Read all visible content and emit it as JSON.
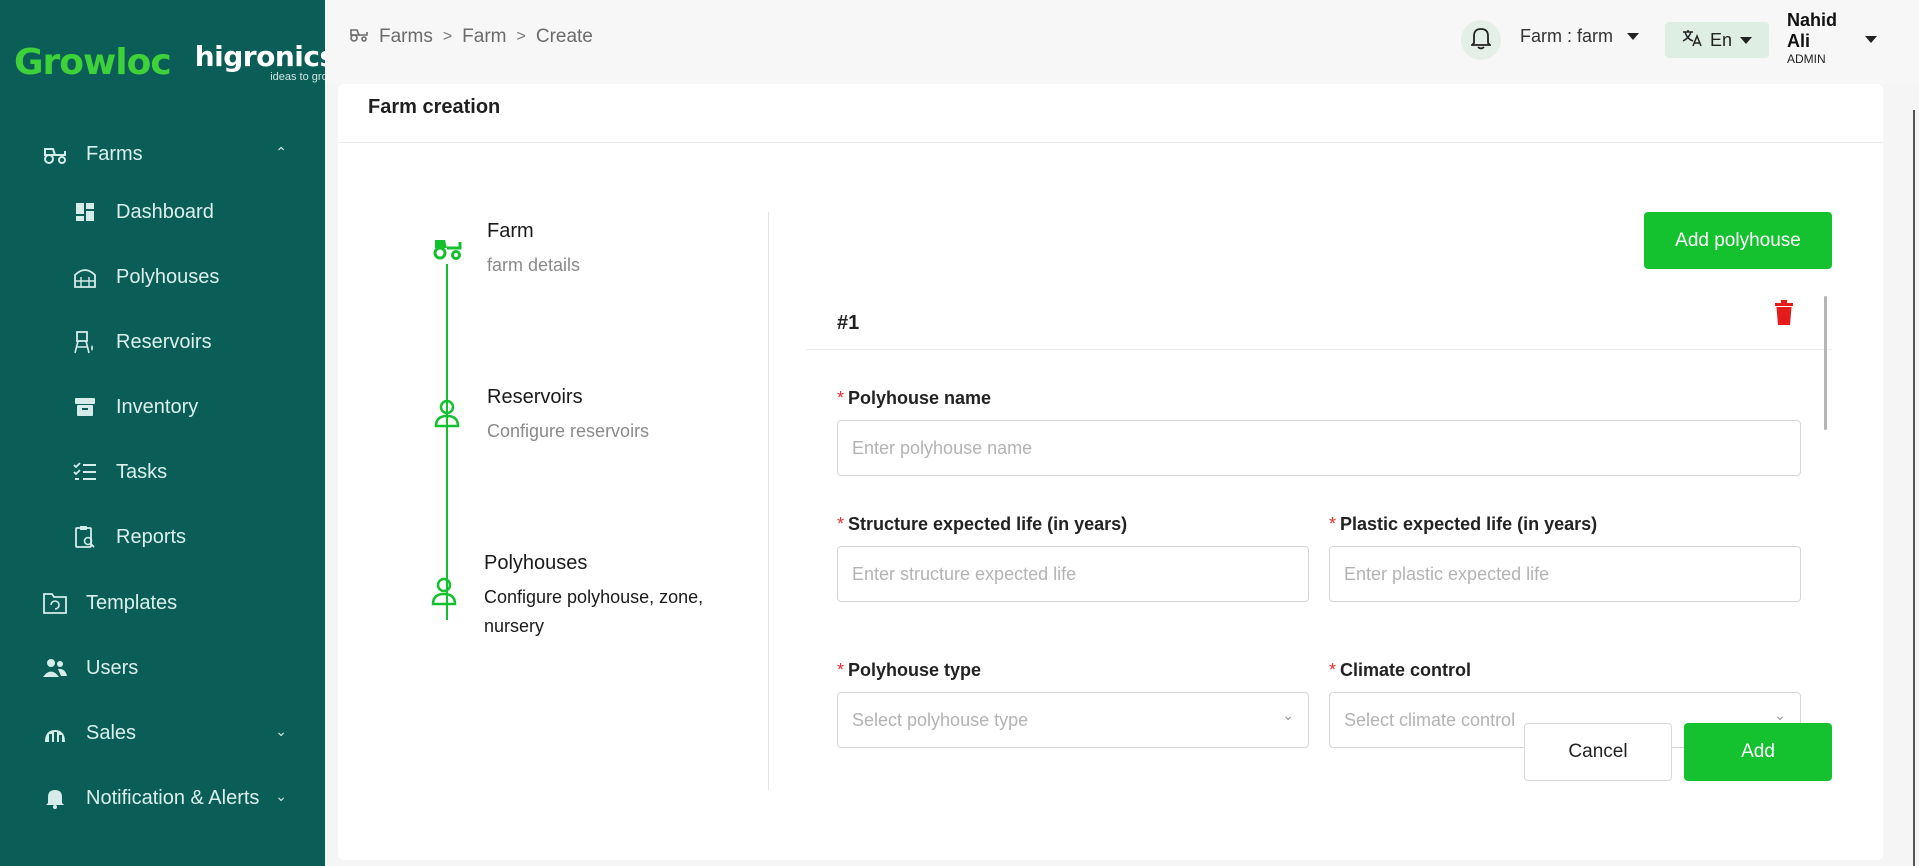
{
  "brand": {
    "primary": "Growloc",
    "secondary": "higronics",
    "tagline": "ideas to grow"
  },
  "sidebar": {
    "items": [
      {
        "label": "Farms",
        "icon": "tractor-icon",
        "level": "top",
        "expanded": true
      },
      {
        "label": "Dashboard",
        "icon": "dashboard-icon",
        "level": "sub"
      },
      {
        "label": "Polyhouses",
        "icon": "greenhouse-icon",
        "level": "sub"
      },
      {
        "label": "Reservoirs",
        "icon": "water-tank-icon",
        "level": "sub"
      },
      {
        "label": "Inventory",
        "icon": "archive-box-icon",
        "level": "sub"
      },
      {
        "label": "Tasks",
        "icon": "checklist-icon",
        "level": "sub"
      },
      {
        "label": "Reports",
        "icon": "report-icon",
        "level": "sub"
      },
      {
        "label": "Templates",
        "icon": "template-icon",
        "level": "top"
      },
      {
        "label": "Users",
        "icon": "users-icon",
        "level": "top"
      },
      {
        "label": "Sales",
        "icon": "sales-chart-icon",
        "level": "top",
        "expanded": false
      },
      {
        "label": "Notification & Alerts",
        "icon": "bell-icon",
        "level": "top",
        "expanded": false
      }
    ]
  },
  "header": {
    "breadcrumbs": [
      "Farms",
      "Farm",
      "Create"
    ],
    "farm_selector": "Farm : farm",
    "language": "En",
    "user": {
      "name_line1": "Nahid",
      "name_line2": "Ali",
      "role": "ADMIN"
    }
  },
  "card": {
    "title": "Farm creation"
  },
  "stepper": {
    "steps": [
      {
        "title": "Farm",
        "description": "farm details",
        "icon": "tractor-icon"
      },
      {
        "title": "Reservoirs",
        "description": "Configure reservoirs",
        "icon": "user-icon"
      },
      {
        "title": "Polyhouses",
        "description_line1": "Configure polyhouse, zone,",
        "description_line2": "nursery",
        "icon": "user-icon"
      }
    ]
  },
  "form": {
    "add_polyhouse_label": "Add polyhouse",
    "polyhouse_number": "#1",
    "fields": {
      "name": {
        "label": "Polyhouse name",
        "placeholder": "Enter polyhouse name"
      },
      "structure_life": {
        "label": "Structure expected life (in years)",
        "placeholder": "Enter structure expected life"
      },
      "plastic_life": {
        "label": "Plastic expected life (in years)",
        "placeholder": "Enter plastic expected life"
      },
      "type": {
        "label": "Polyhouse type",
        "placeholder": "Select polyhouse type"
      },
      "climate": {
        "label": "Climate control",
        "placeholder": "Select climate control"
      }
    },
    "required_marker": "*",
    "cancel_label": "Cancel",
    "add_label": "Add"
  },
  "colors": {
    "sidebar_bg": "#0b5e57",
    "accent_green": "#14c12f",
    "delete_red": "#e61b1b",
    "required_red": "#ee2f2f"
  }
}
